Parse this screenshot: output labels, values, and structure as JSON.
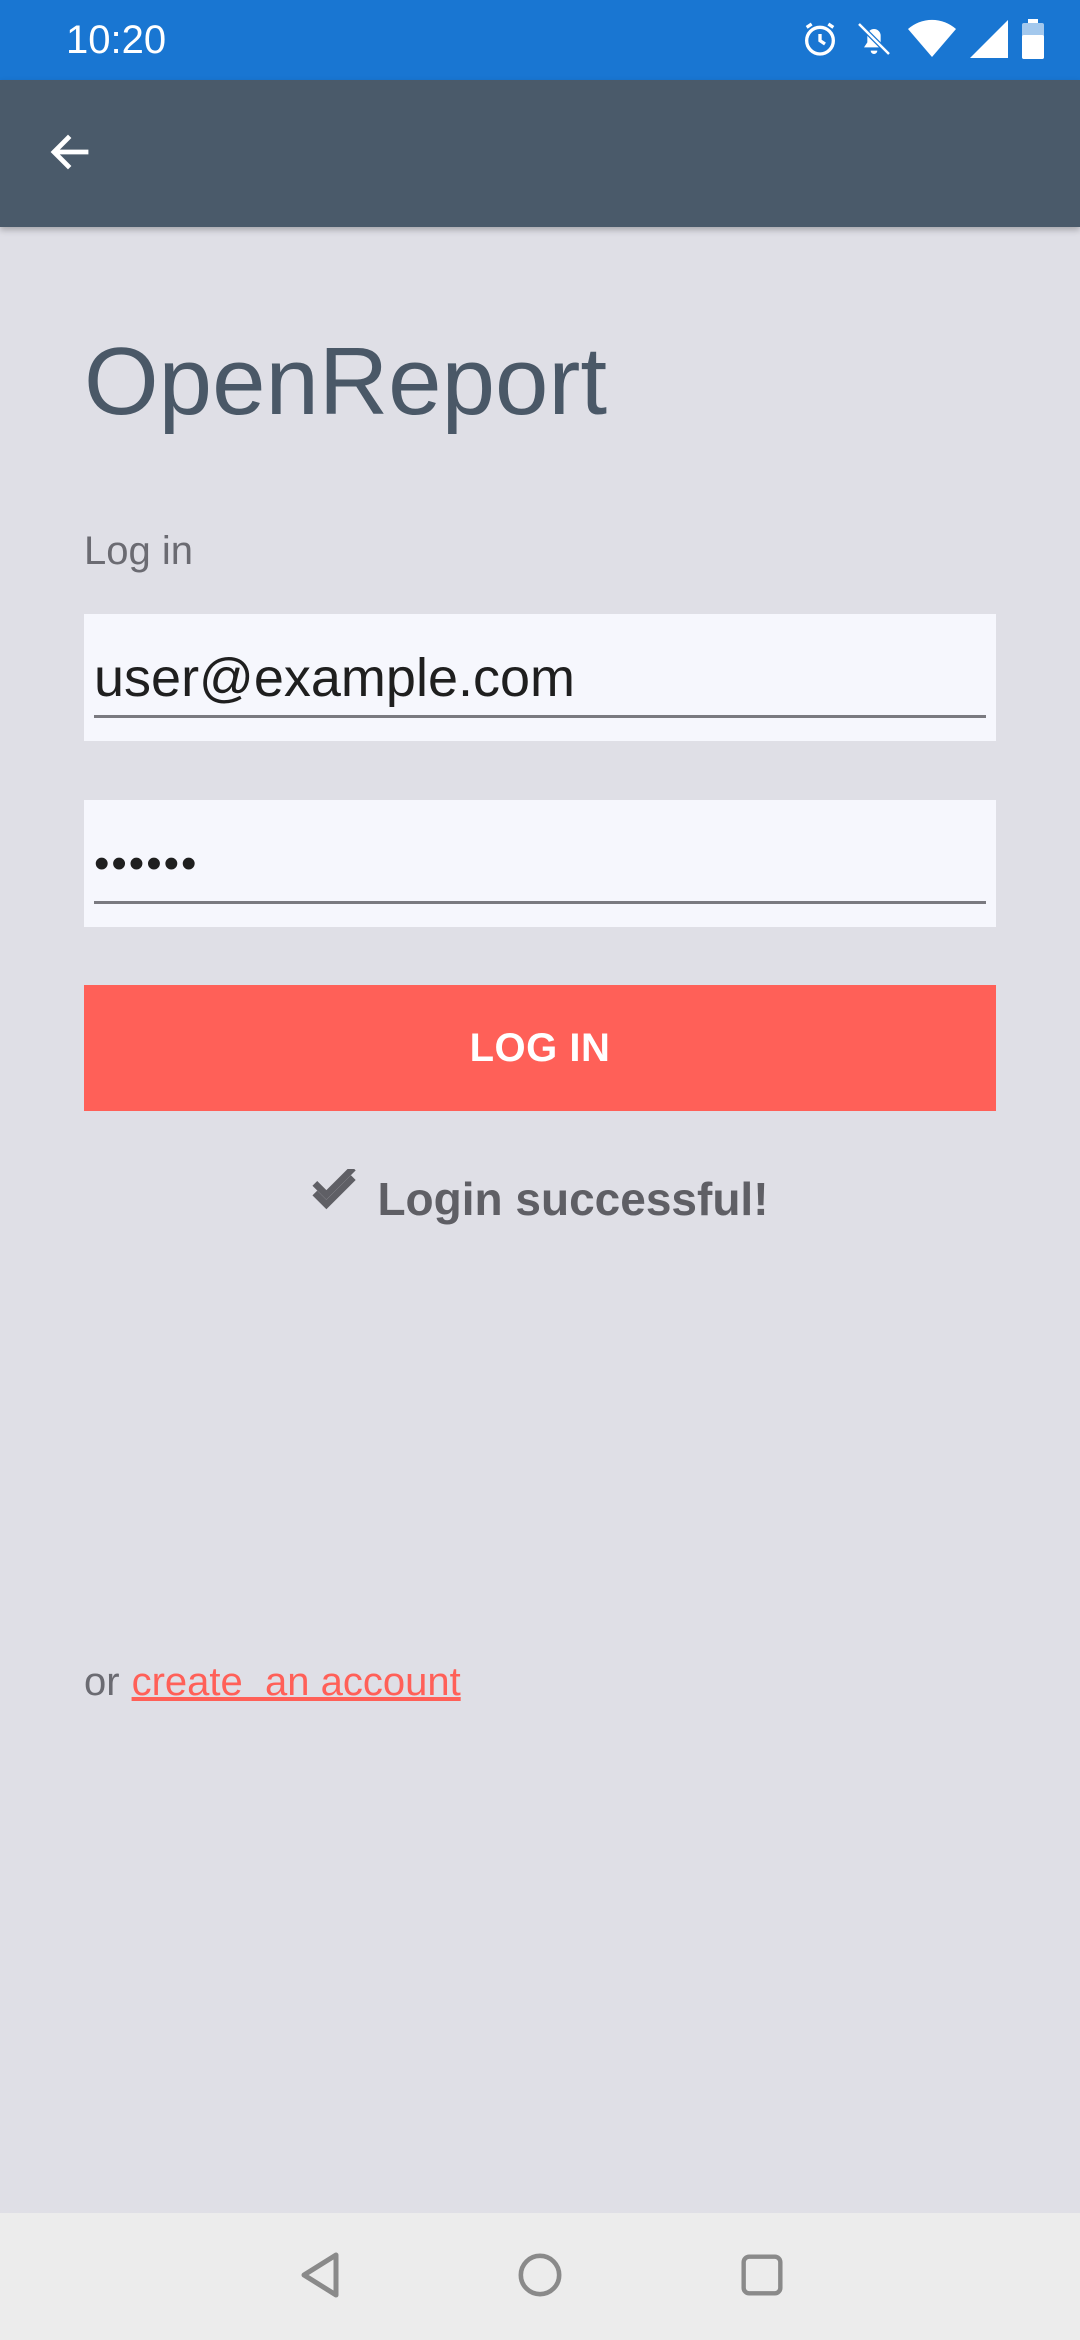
{
  "status_bar": {
    "time": "10:20",
    "icons": [
      "alarm-icon",
      "notifications-off-icon",
      "wifi-icon",
      "signal-icon",
      "battery-icon"
    ]
  },
  "app_bar": {
    "back_icon": "arrow-back-icon"
  },
  "login": {
    "app_title": "OpenReport",
    "section_label": "Log in",
    "email_value": "user@example.com",
    "password_value": "••••••",
    "button_label": "LOG IN",
    "success_message": "Login successful!",
    "success_icon": "double-check-icon"
  },
  "footer": {
    "or_text": "or",
    "create_account_link": "create  an account"
  },
  "nav_bar": {
    "icons": [
      "back-triangle-icon",
      "home-circle-icon",
      "recents-square-icon"
    ]
  },
  "colors": {
    "status_bar": "#1976d2",
    "app_bar": "#4a5a6a",
    "background": "#dfdfe6",
    "accent": "#ff6058",
    "title": "#4a5867"
  }
}
